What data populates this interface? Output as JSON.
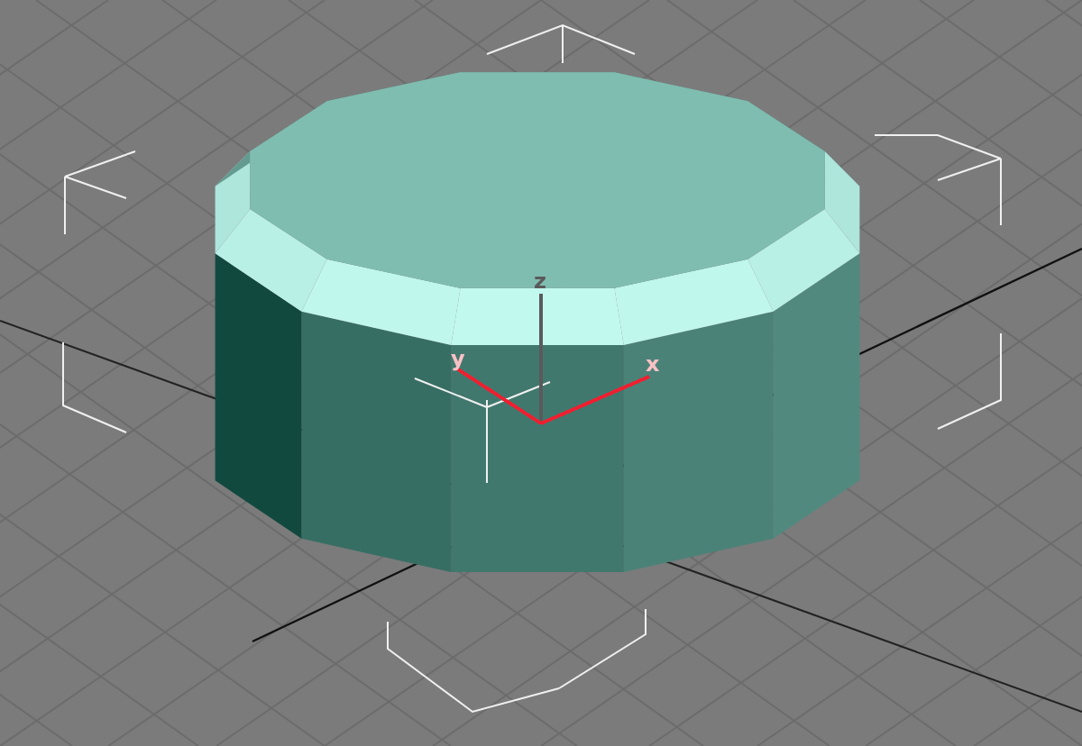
{
  "viewport": {
    "axes": [
      {
        "label": "z",
        "color": "#5a5a5a"
      },
      {
        "label": "y",
        "color": "#ee2030"
      },
      {
        "label": "x",
        "color": "#ee2030"
      }
    ]
  }
}
